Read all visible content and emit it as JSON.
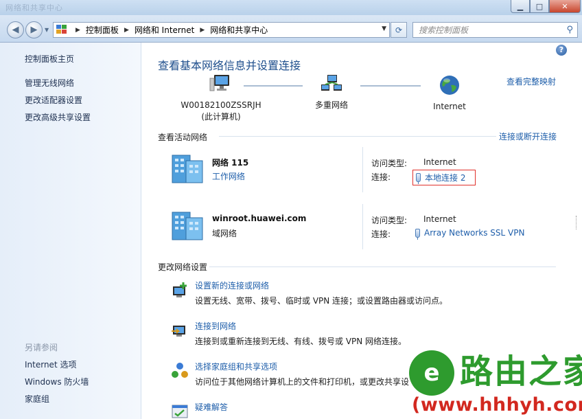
{
  "titlebar": {
    "ghost_text": "网络和共享中心"
  },
  "window_buttons": {
    "minimize": "▁",
    "maximize": "□",
    "close": "✕"
  },
  "nav": {
    "back": "◀",
    "forward": "▶",
    "breadcrumbs": [
      "控制面板",
      "网络和 Internet",
      "网络和共享中心"
    ],
    "search_placeholder": "搜索控制面板"
  },
  "left": {
    "home": "控制面板主页",
    "links": [
      "管理无线网络",
      "更改适配器设置",
      "更改高级共享设置"
    ],
    "see_also_label": "另请参阅",
    "see_also": [
      "Internet 选项",
      "Windows 防火墙",
      "家庭组"
    ]
  },
  "main": {
    "title": "查看基本网络信息并设置连接",
    "full_map_link": "查看完整映射",
    "map": {
      "computer_name": "W00182100ZSSRJH",
      "computer_sub": "(此计算机)",
      "multi_network": "多重网络",
      "internet": "Internet"
    },
    "active_header": "查看活动网络",
    "connect_disconnect_link": "连接或断开连接",
    "networks": [
      {
        "name": "网络  115",
        "kind": "工作网络",
        "access_label": "访问类型:",
        "access_value": "Internet",
        "conn_label": "连接:",
        "conn_value": "本地连接 2"
      },
      {
        "name": "winroot.huawei.com",
        "kind": "域网络",
        "access_label": "访问类型:",
        "access_value": "Internet",
        "conn_label": "连接:",
        "conn_value": "Array Networks SSL VPN"
      }
    ],
    "change_header": "更改网络设置",
    "tasks": [
      {
        "title": "设置新的连接或网络",
        "desc": "设置无线、宽带、拨号、临时或 VPN 连接；或设置路由器或访问点。"
      },
      {
        "title": "连接到网络",
        "desc": "连接到或重新连接到无线、有线、拨号或 VPN 网络连接。"
      },
      {
        "title": "选择家庭组和共享选项",
        "desc": "访问位于其他网络计算机上的文件和打印机，或更改共享设"
      },
      {
        "title": "疑难解答",
        "desc": ""
      }
    ]
  },
  "watermark": {
    "logo_glyph": "e",
    "brand": "路由之家",
    "url": "(www.hhhyh.com)"
  }
}
